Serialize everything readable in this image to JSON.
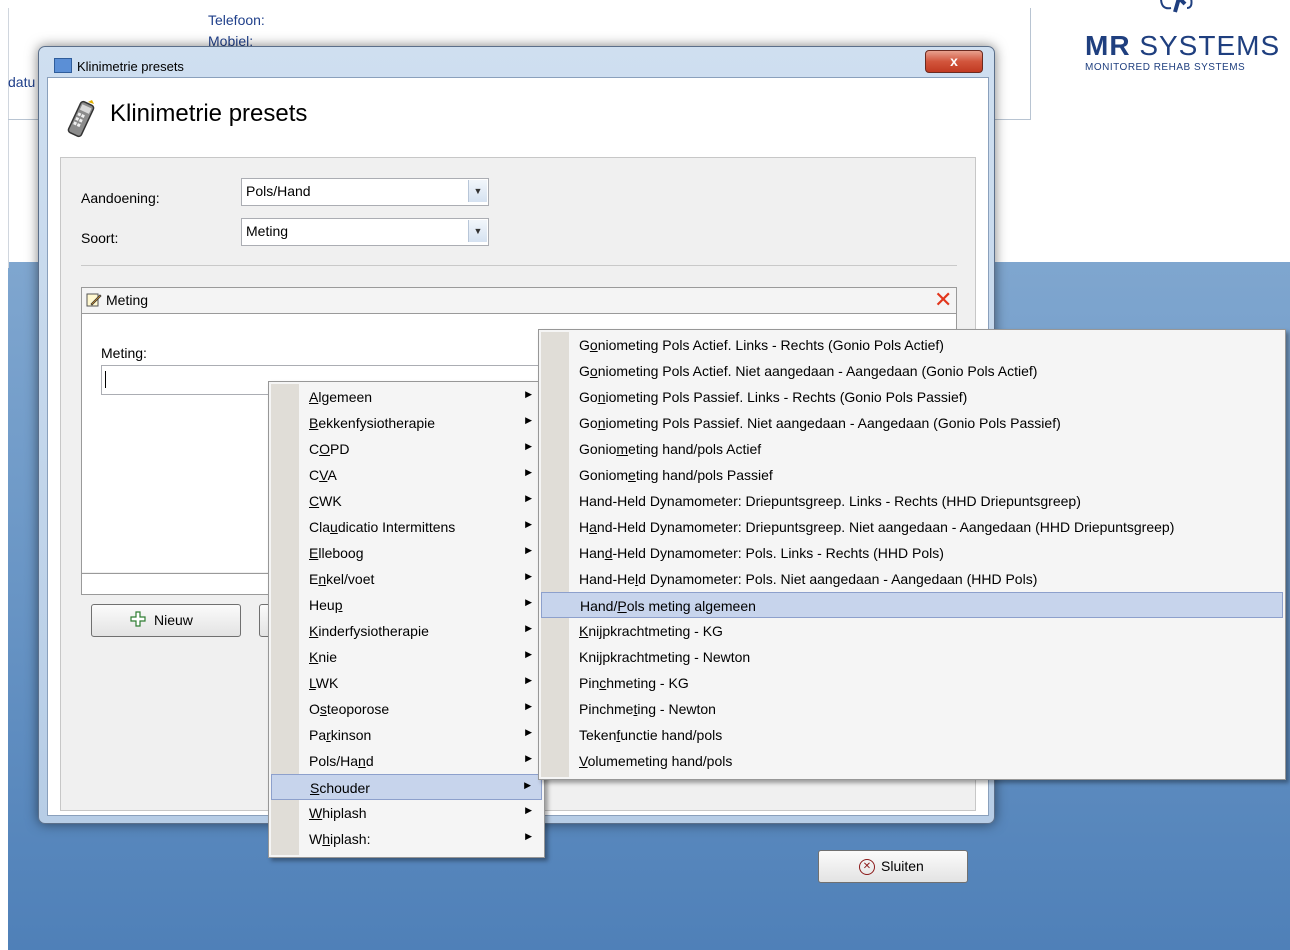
{
  "background": {
    "labels": {
      "telefoon": "Telefoon:",
      "mobiel": "Mobiel:",
      "datum_partial": "datu"
    },
    "logo": {
      "title_bold": "MR",
      "title_rest": " SYSTEMS",
      "subtitle": "MONITORED REHAB SYSTEMS"
    }
  },
  "dialog": {
    "window_title": "Klinimetrie presets",
    "close_label": "x",
    "header_title": "Klinimetrie presets",
    "fields": {
      "aandoening_label": "Aandoening:",
      "aandoening_value": "Pols/Hand",
      "soort_label": "Soort:",
      "soort_value": "Meting"
    },
    "panel": {
      "title": "Meting",
      "field_label": "Meting:",
      "field_value": ""
    },
    "buttons": {
      "nieuw": "Nieuw",
      "sluiten": "Sluiten"
    }
  },
  "menu_main": {
    "highlighted_index": 15,
    "items": [
      {
        "pre": "",
        "u": "A",
        "post": "lgemeen"
      },
      {
        "pre": "",
        "u": "B",
        "post": "ekkenfysiotherapie"
      },
      {
        "pre": "C",
        "u": "O",
        "post": "PD"
      },
      {
        "pre": "C",
        "u": "V",
        "post": "A"
      },
      {
        "pre": "",
        "u": "C",
        "post": "WK"
      },
      {
        "pre": "Cla",
        "u": "u",
        "post": "dicatio Intermittens"
      },
      {
        "pre": "",
        "u": "E",
        "post": "lleboog"
      },
      {
        "pre": "E",
        "u": "n",
        "post": "kel/voet"
      },
      {
        "pre": "Heu",
        "u": "p",
        "post": ""
      },
      {
        "pre": "",
        "u": "K",
        "post": "inderfysiotherapie"
      },
      {
        "pre": "",
        "u": "K",
        "post": "nie"
      },
      {
        "pre": "",
        "u": "L",
        "post": "WK"
      },
      {
        "pre": "O",
        "u": "s",
        "post": "teoporose"
      },
      {
        "pre": "Pa",
        "u": "r",
        "post": "kinson"
      },
      {
        "pre": "Pols/Ha",
        "u": "n",
        "post": "d"
      },
      {
        "pre": "",
        "u": "S",
        "post": "chouder"
      },
      {
        "pre": "",
        "u": "W",
        "post": "hiplash"
      },
      {
        "pre": "W",
        "u": "h",
        "post": "iplash:"
      }
    ],
    "submenu_arrow": "▶"
  },
  "menu_sub": {
    "highlighted_index": 10,
    "items": [
      {
        "pre": "G",
        "u": "o",
        "post": "niometing Pols Actief. Links - Rechts  (Gonio Pols Actief)"
      },
      {
        "pre": "G",
        "u": "o",
        "post": "niometing Pols Actief. Niet aangedaan - Aangedaan  (Gonio Pols Actief)"
      },
      {
        "pre": "Go",
        "u": "n",
        "post": "iometing Pols Passief. Links - Rechts  (Gonio Pols Passief)"
      },
      {
        "pre": "Go",
        "u": "n",
        "post": "iometing Pols Passief. Niet aangedaan - Aangedaan  (Gonio Pols Passief)"
      },
      {
        "pre": "Gonio",
        "u": "m",
        "post": "eting hand/pols Actief"
      },
      {
        "pre": "Goniom",
        "u": "e",
        "post": "ting hand/pols Passief"
      },
      {
        "pre": "Hand-Held Dynamometer: Driepuntsgreep. Links - Rechts (HHD Driepuntsgreep)",
        "u": "",
        "post": ""
      },
      {
        "pre": "H",
        "u": "a",
        "post": "nd-Held Dynamometer: Driepuntsgreep. Niet aangedaan - Aangedaan (HHD Driepuntsgreep)"
      },
      {
        "pre": "Han",
        "u": "d",
        "post": "-Held Dynamometer: Pols. Links - Rechts  (HHD Pols)"
      },
      {
        "pre": "Hand-He",
        "u": "l",
        "post": "d Dynamometer: Pols. Niet aangedaan - Aangedaan  (HHD Pols)"
      },
      {
        "pre": "Hand/",
        "u": "P",
        "post": "ols meting algemeen"
      },
      {
        "pre": "",
        "u": "K",
        "post": "nijpkrachtmeting - KG"
      },
      {
        "pre": "Kni",
        "u": "j",
        "post": "pkrachtmeting - Newton"
      },
      {
        "pre": "Pin",
        "u": "c",
        "post": "hmeting - KG"
      },
      {
        "pre": "Pinchme",
        "u": "t",
        "post": "ing - Newton"
      },
      {
        "pre": "Teken",
        "u": "f",
        "post": "unctie hand/pols"
      },
      {
        "pre": "",
        "u": "V",
        "post": "olumemeting hand/pols"
      }
    ]
  },
  "colors": {
    "accent": "#1f3f7f",
    "highlight": "#c7d4ec",
    "close_red": "#e2361c"
  }
}
